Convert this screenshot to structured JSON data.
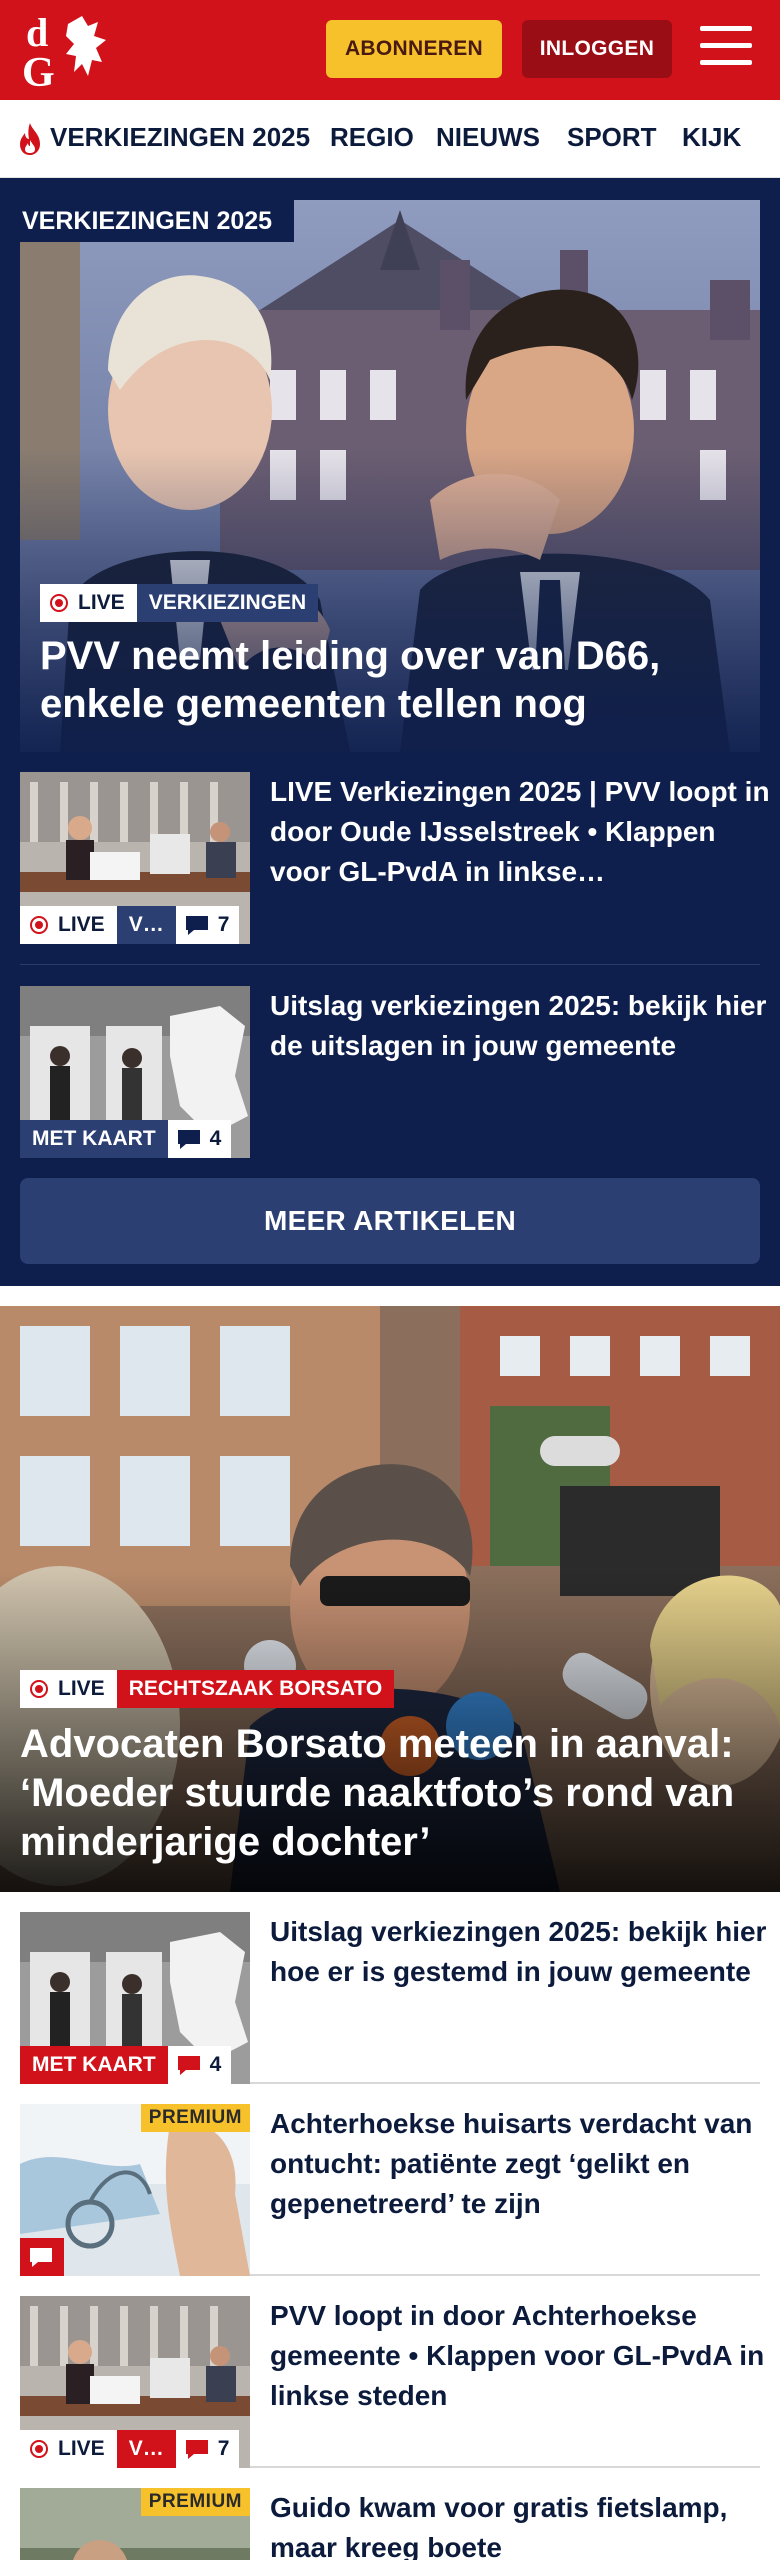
{
  "header": {
    "subscribe_label": "ABONNEREN",
    "login_label": "INLOGGEN",
    "brand_color": "#d1121b"
  },
  "nav": {
    "items": [
      "VERKIEZINGEN 2025",
      "REGIO",
      "NIEUWS",
      "SPORT",
      "KIJK"
    ]
  },
  "elections": {
    "section_label": "VERKIEZINGEN 2025",
    "hero": {
      "live_label": "LIVE",
      "category": "VERKIEZINGEN",
      "title": "PVV neemt leiding over van D66, enkele gemeenten tellen nog"
    },
    "articles": [
      {
        "title": "LIVE Verkiezingen 2025 | PVV loopt in door Oude IJsselstreek • Klappen voor GL-PvdA in linkse…",
        "live_label": "LIVE",
        "category_short": "V…",
        "comments": "7"
      },
      {
        "title": "Uitslag verkiezingen 2025: bekijk hier de uitslagen in jouw gemeente",
        "map_label": "MET KAART",
        "comments": "4"
      }
    ],
    "more_label": "MEER ARTIKELEN"
  },
  "top_story": {
    "live_label": "LIVE",
    "category": "RECHTSZAAK BORSATO",
    "title": "Advocaten Borsato meteen in aanval: ‘Moeder stuurde naaktfoto’s rond van minderjarige dochter’"
  },
  "list": [
    {
      "title": "Uitslag verkiezingen 2025: bekijk hier hoe er is gestemd in jouw gemeente",
      "map_label": "MET KAART",
      "comments": "4"
    },
    {
      "title": "Achterhoekse huisarts verdacht van ontucht: patiënte zegt ‘gelikt en gepenetreerd’ te zijn",
      "premium_label": "PREMIUM"
    },
    {
      "title": "PVV loopt in door Achterhoekse gemeente • Klappen voor GL-PvdA in linkse steden",
      "live_label": "LIVE",
      "category_short": "V…",
      "comments": "7"
    },
    {
      "title": "Guido kwam voor gratis fietslamp, maar kreeg boete",
      "premium_label": "PREMIUM"
    }
  ]
}
